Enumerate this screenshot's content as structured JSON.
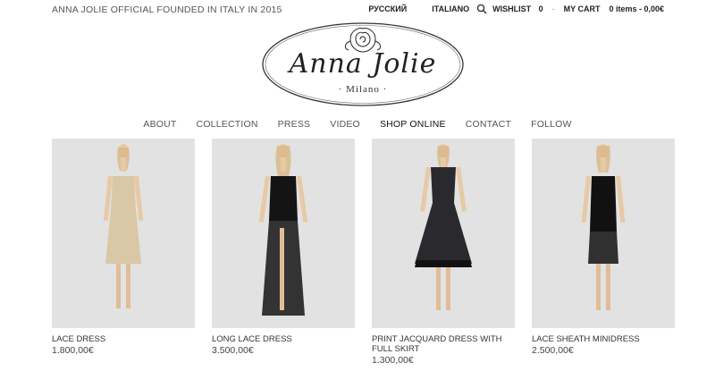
{
  "header": {
    "tagline": "ANNA JOLIE OFFICIAL FOUNDED IN ITALY IN 2015",
    "lang_ru": "РУССКИЙ",
    "lang_it": "ITALIANO",
    "wishlist_label": "WISHLIST",
    "wishlist_count": "0",
    "separator": "-",
    "cart_label": "MY CART",
    "cart_summary": "0 items - 0,00€"
  },
  "logo": {
    "name": "Anna Jolie",
    "subtitle": "· Milano ·"
  },
  "nav": {
    "items": [
      "ABOUT",
      "COLLECTION",
      "PRESS",
      "VIDEO",
      "SHOP ONLINE",
      "CONTACT",
      "FOLLOW"
    ]
  },
  "products": [
    {
      "name": "LACE DRESS",
      "price": "1.800,00€",
      "dress_color": "#d9c7a6"
    },
    {
      "name": "LONG LACE DRESS",
      "price": "3.500,00€",
      "dress_color": "#141414"
    },
    {
      "name": "PRINT JACQUARD DRESS WITH FULL SKIRT",
      "price": "1.300,00€",
      "dress_color": "#2a2a2e"
    },
    {
      "name": "LACE SHEATH MINIDRESS",
      "price": "2.500,00€",
      "dress_color": "#111111"
    }
  ],
  "icons": {
    "search": "search-icon",
    "logo_flower": "rose-icon"
  },
  "colors": {
    "photo_bg": "#e2e2e2",
    "text": "#333333"
  }
}
